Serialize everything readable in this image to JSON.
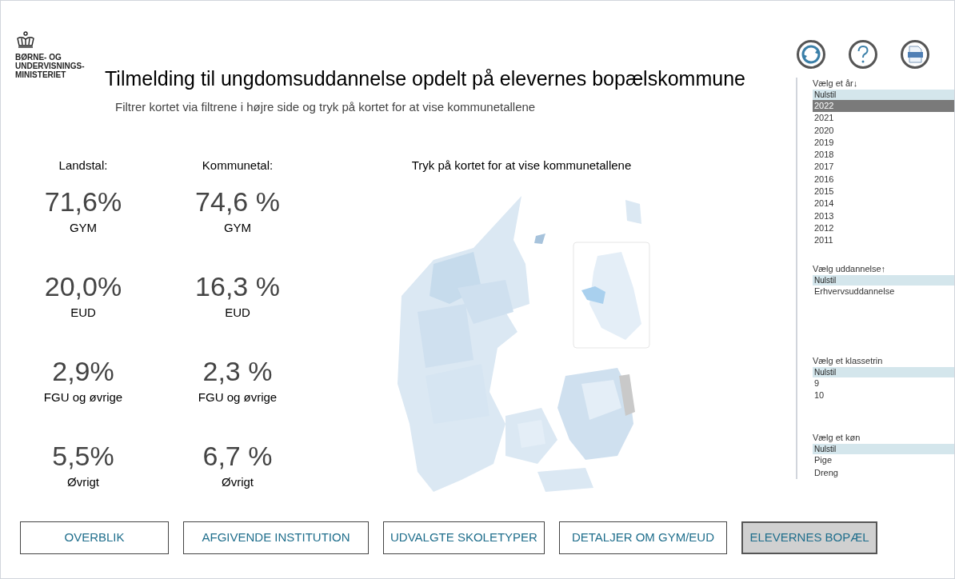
{
  "logo": {
    "lines": [
      "BØRNE- OG",
      "UNDERVISNINGS-",
      "MINISTERIET"
    ]
  },
  "title": "Tilmelding til ungdomsuddannelse opdelt på elevernes bopælskommune",
  "subtitle": "Filtrer kortet via filtrene i højre side og tryk på kortet for at vise kommunetallene",
  "stats": [
    {
      "heading": "Landstal:",
      "items": [
        {
          "value": "71,6%",
          "label": "GYM"
        },
        {
          "value": "20,0%",
          "label": "EUD"
        },
        {
          "value": "2,9%",
          "label": "FGU og øvrige"
        },
        {
          "value": "5,5%",
          "label": "Øvrigt"
        }
      ]
    },
    {
      "heading": "Kommunetal:",
      "items": [
        {
          "value": "74,6 %",
          "label": "GYM"
        },
        {
          "value": "16,3 %",
          "label": "EUD"
        },
        {
          "value": "2,3 %",
          "label": "FGU og øvrige"
        },
        {
          "value": "6,7 %",
          "label": "Øvrigt"
        }
      ]
    }
  ],
  "map": {
    "caption": "Tryk på kortet for at vise kommunetallene"
  },
  "filters": [
    {
      "title": "Vælg et år↓",
      "reset": "Nulstil",
      "options": [
        {
          "label": "2022",
          "selected": true
        },
        {
          "label": "2021",
          "selected": false
        },
        {
          "label": "2020",
          "selected": false
        },
        {
          "label": "2019",
          "selected": false
        },
        {
          "label": "2018",
          "selected": false
        },
        {
          "label": "2017",
          "selected": false
        },
        {
          "label": "2016",
          "selected": false
        },
        {
          "label": "2015",
          "selected": false
        },
        {
          "label": "2014",
          "selected": false
        },
        {
          "label": "2013",
          "selected": false
        },
        {
          "label": "2012",
          "selected": false
        },
        {
          "label": "2011",
          "selected": false
        }
      ]
    },
    {
      "title": "Vælg uddannelse↑",
      "reset": "Nulstil",
      "options": [
        {
          "label": "Erhvervsuddannelse",
          "selected": false
        }
      ]
    },
    {
      "title": "Vælg et klassetrin",
      "reset": "Nulstil",
      "options": [
        {
          "label": "9",
          "selected": false
        },
        {
          "label": "10",
          "selected": false
        }
      ]
    },
    {
      "title": "Vælg et køn",
      "reset": "Nulstil",
      "options": [
        {
          "label": "Pige",
          "selected": false
        },
        {
          "label": "Dreng",
          "selected": false
        }
      ]
    }
  ],
  "nav_buttons": [
    {
      "label": "OVERBLIK",
      "selected": false
    },
    {
      "label": "AFGIVENDE INSTITUTION",
      "selected": false
    },
    {
      "label": "UDVALGTE SKOLETYPER",
      "selected": false
    },
    {
      "label": "DETALJER OM GYM/EUD",
      "selected": false
    },
    {
      "label": "ELEVERNES BOPÆL",
      "selected": true
    }
  ]
}
